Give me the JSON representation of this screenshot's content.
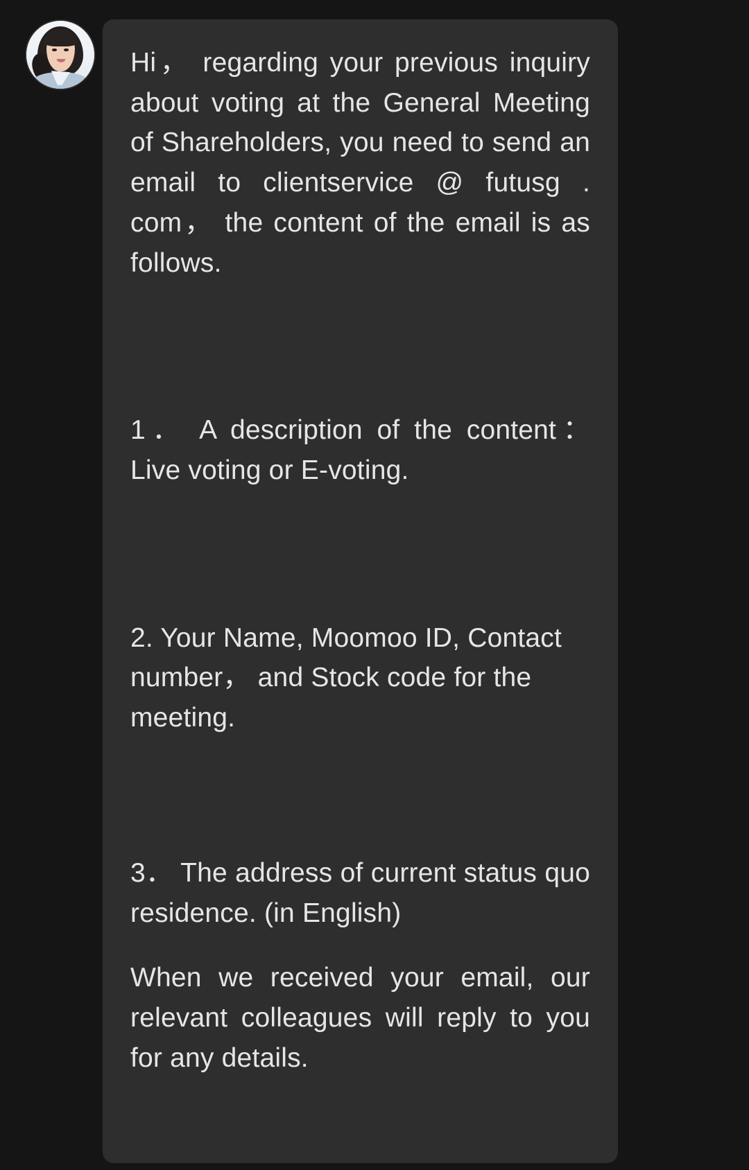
{
  "theme": {
    "page_background": "#151515",
    "bubble_background": "#2e2e2e",
    "text_color": "#e6e6e6"
  },
  "message": {
    "sender_avatar": "agent-avatar-photo",
    "paragraphs": [
      "Hi， regarding your previous inquiry about voting at the General Meeting of Shareholders, you need to send an email to clientservice @ futusg . com， the content of the email is as follows.",
      "1． A description of the content： Live voting or E-voting.",
      "2. Your Name, Moomoo ID, Contact number， and Stock code for the meeting.",
      "3． The address of current status quo residence. (in English)",
      "When we received your email, our relevant colleagues will reply to you for any details."
    ]
  }
}
